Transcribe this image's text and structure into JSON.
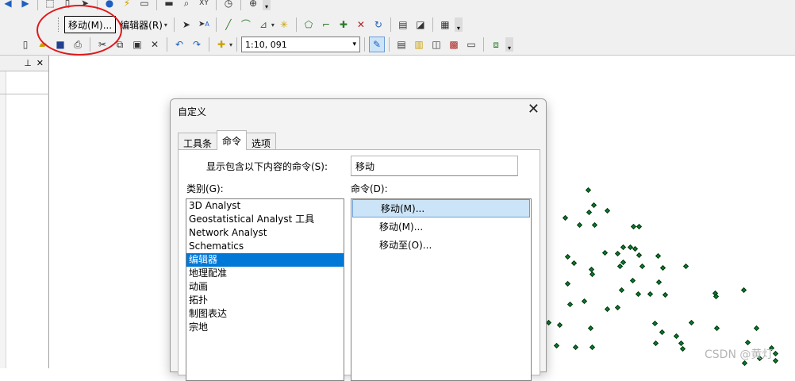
{
  "toolbar": {
    "move_label": "移动(M)...",
    "editor_menu": "编辑器(R)",
    "scale_value": "1:10, 091"
  },
  "left_pane": {
    "pin_icon": "pin-icon",
    "close_glyph": "✕"
  },
  "dialog": {
    "title": "自定义",
    "close_glyph": "✕",
    "tabs": [
      "工具条",
      "命令",
      "选项"
    ],
    "search_label": "显示包含以下内容的命令(S):",
    "search_value": "移动",
    "categories_label": "类别(G):",
    "categories": [
      "3D Analyst",
      "Geostatistical Analyst 工具",
      "Network Analyst",
      "Schematics",
      "编辑器",
      "地理配准",
      "动画",
      "拓扑",
      "制图表达",
      "宗地"
    ],
    "selected_category_index": 4,
    "commands_label": "命令(D):",
    "commands": [
      "移动(M)...",
      "移动(M)...",
      "移动至(O)..."
    ],
    "selected_command_index": 0
  },
  "watermark": "CSDN @黄灯",
  "colors": {
    "selection_blue": "#0078d7",
    "command_highlight": "#cce4f7",
    "annotation_red": "#e0191c",
    "point_green": "#0e7a2e"
  }
}
